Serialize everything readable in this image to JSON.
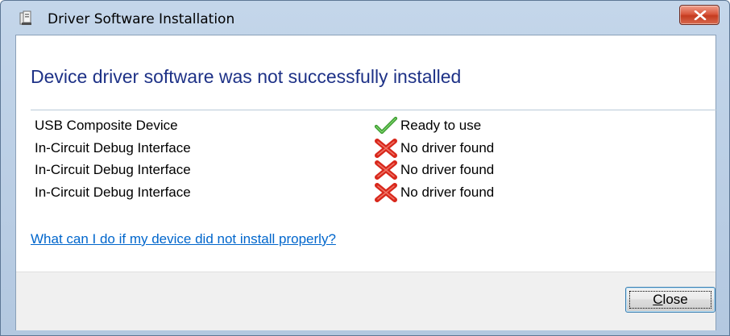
{
  "window": {
    "title": "Driver Software Installation",
    "title_icon": "driver-install-icon",
    "close_glyph": "close-icon"
  },
  "main": {
    "heading": "Device driver software was not successfully installed",
    "devices": [
      {
        "name": "USB Composite Device",
        "status": "Ready to use",
        "status_icon": "checkmark-icon",
        "status_color": "#3a9b2e"
      },
      {
        "name": "In-Circuit Debug Interface",
        "status": "No driver found",
        "status_icon": "error-x-icon",
        "status_color": "#d8281c"
      },
      {
        "name": "In-Circuit Debug Interface",
        "status": "No driver found",
        "status_icon": "error-x-icon",
        "status_color": "#d8281c"
      },
      {
        "name": "In-Circuit Debug Interface",
        "status": "No driver found",
        "status_icon": "error-x-icon",
        "status_color": "#d8281c"
      }
    ],
    "help_link": "What can I do if my device did not install properly?"
  },
  "footer": {
    "close_label_first": "C",
    "close_label_rest": "lose"
  },
  "colors": {
    "heading": "#1e3287",
    "link": "#0066cc",
    "title_bar": "#c4d6ea",
    "close_button_red": "#c53b1f"
  }
}
